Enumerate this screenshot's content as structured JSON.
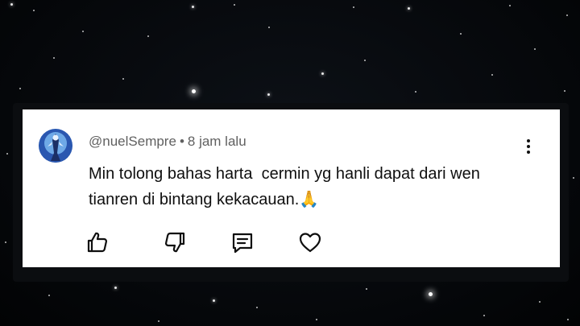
{
  "comment": {
    "username": "@nuelSempre",
    "separator": "•",
    "time": "8 jam lalu",
    "text": "Min tolong bahas harta  cermin yg hanli dapat dari wen tianren di bintang kekacauan.🙏"
  },
  "actions": {
    "like_icon": "thumbs-up-icon",
    "dislike_icon": "thumbs-down-icon",
    "reply_icon": "comment-icon",
    "heart_icon": "heart-icon",
    "menu_icon": "more-vertical-icon"
  },
  "colors": {
    "background": "#05070a",
    "card": "#ffffff",
    "meta_text": "#606060",
    "body_text": "#0f0f0f"
  }
}
